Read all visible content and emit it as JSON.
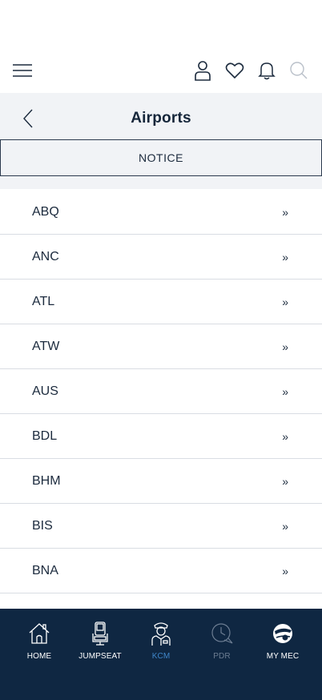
{
  "header": {
    "icons": [
      "menu-icon",
      "user-icon",
      "heart-icon",
      "bell-icon",
      "search-icon"
    ]
  },
  "page": {
    "title": "Airports",
    "notice_label": "NOTICE"
  },
  "airports": [
    {
      "code": "ABQ",
      "chevron": "»"
    },
    {
      "code": "ANC",
      "chevron": "»"
    },
    {
      "code": "ATL",
      "chevron": "»"
    },
    {
      "code": "ATW",
      "chevron": "»"
    },
    {
      "code": "AUS",
      "chevron": "»"
    },
    {
      "code": "BDL",
      "chevron": "»"
    },
    {
      "code": "BHM",
      "chevron": "»"
    },
    {
      "code": "BIS",
      "chevron": "»"
    },
    {
      "code": "BNA",
      "chevron": "»"
    }
  ],
  "bottom_nav": {
    "items": [
      {
        "label": "HOME",
        "icon": "home-icon",
        "state": "normal"
      },
      {
        "label": "JUMPSEAT",
        "icon": "seat-icon",
        "state": "normal"
      },
      {
        "label": "KCM",
        "icon": "pilot-icon",
        "state": "active"
      },
      {
        "label": "PDR",
        "icon": "clock-plane-icon",
        "state": "disabled"
      },
      {
        "label": "MY MEC",
        "icon": "globe-logo-icon",
        "state": "normal"
      }
    ]
  },
  "colors": {
    "nav_background": "#0f2742",
    "active": "#3f86c9",
    "disabled": "#6c7d92",
    "band": "#f1f3f6"
  }
}
